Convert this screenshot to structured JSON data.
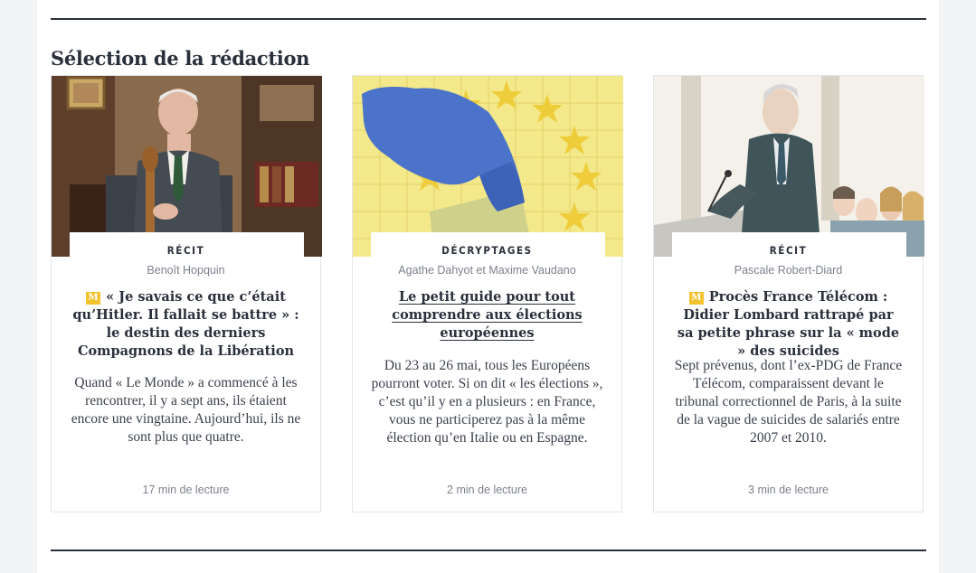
{
  "section": {
    "title": "Sélection de la rédaction"
  },
  "cards": [
    {
      "kicker": "RÉCIT",
      "author": "Benoît Hopquin",
      "badge": "M",
      "headline": "« Je savais ce que c’était qu’Hitler. Il fallait se battre » : le destin des derniers Compagnons de la Libération",
      "excerpt": "Quand « Le Monde » a commencé à les rencontrer, il y a sept ans, ils étaient encore une vingtaine. Aujourd’hui, ils ne sont plus que quatre.",
      "readtime": "17 min de lecture",
      "image": "portrait-photo-elderly-man"
    },
    {
      "kicker": "DÉCRYPTAGES",
      "author": "Agathe Dahyot et Maxime Vaudano",
      "headline": "Le petit guide pour tout comprendre aux élections européennes",
      "excerpt": "Du 23 au 26 mai, tous les Européens pourront voter. Si on dit « les élections », c’est qu’il y en a plusieurs : en France, vous ne participerez pas à la même élection qu’en Italie ou en Espagne.",
      "readtime": "2 min de lecture",
      "image": "illustration-ballot-hand-eu-stars"
    },
    {
      "kicker": "RÉCIT",
      "author": "Pascale Robert-Diard",
      "badge": "M",
      "headline": "Procès France Télécom : Didier Lombard rattrapé par sa petite phrase sur la « mode » des suicides",
      "excerpt": "Sept prévenus, dont l’ex-PDG de France Télécom, comparaissent devant le tribunal correctionnel de Paris, à la suite de la vague de suicides de salariés entre 2007 et 2010.",
      "readtime": "3 min de lecture",
      "image": "courtroom-sketch"
    }
  ],
  "colors": {
    "text": "#2a303b",
    "meta": "#7c818b",
    "badge": "#f2c230",
    "background": "#f3f4f6"
  }
}
